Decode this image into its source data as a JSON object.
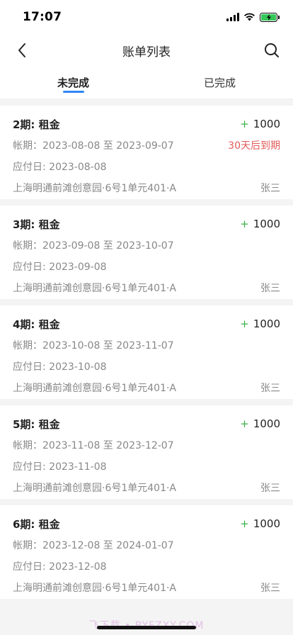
{
  "status": {
    "time": "17:07"
  },
  "nav": {
    "title": "账单列表"
  },
  "tabs": [
    {
      "label": "未完成",
      "active": true
    },
    {
      "label": "已完成",
      "active": false
    }
  ],
  "labels": {
    "plus": "+",
    "period_prefix": "帐期：",
    "due_prefix": "应付日: "
  },
  "bills": [
    {
      "title": "2期: 租金",
      "amount": "1000",
      "period": "2023-08-08 至 2023-09-07",
      "due_notice": "30天后到期",
      "due_date": "2023-08-08",
      "address": "上海明通前滩创意园·6号1单元401·A",
      "tenant": "张三"
    },
    {
      "title": "3期: 租金",
      "amount": "1000",
      "period": "2023-09-08 至 2023-10-07",
      "due_notice": "",
      "due_date": "2023-09-08",
      "address": "上海明通前滩创意园·6号1单元401·A",
      "tenant": "张三"
    },
    {
      "title": "4期: 租金",
      "amount": "1000",
      "period": "2023-10-08 至 2023-11-07",
      "due_notice": "",
      "due_date": "2023-10-08",
      "address": "上海明通前滩创意园·6号1单元401·A",
      "tenant": "张三"
    },
    {
      "title": "5期: 租金",
      "amount": "1000",
      "period": "2023-11-08 至 2023-12-07",
      "due_notice": "",
      "due_date": "2023-11-08",
      "address": "上海明通前滩创意园·6号1单元401·A",
      "tenant": "张三"
    },
    {
      "title": "6期: 租金",
      "amount": "1000",
      "period": "2023-12-08 至 2024-01-07",
      "due_notice": "",
      "due_date": "2023-12-08",
      "address": "上海明通前滩创意园·6号1单元401·A",
      "tenant": "张三"
    }
  ],
  "watermark": "飞下载 • BYFZXY.COM",
  "colors": {
    "accent": "#2f86f6",
    "positive": "#3cb04a",
    "warning": "#e35b5b",
    "battery": "#34c759"
  },
  "icons": {
    "back": "chevron-left-icon",
    "search": "search-icon",
    "signal": "signal-icon",
    "wifi": "wifi-icon",
    "battery": "battery-icon"
  }
}
